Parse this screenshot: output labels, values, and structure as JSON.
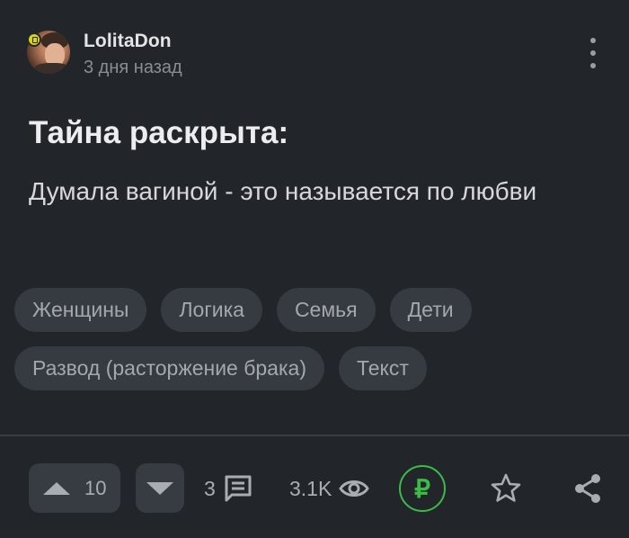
{
  "author": {
    "username": "LolitaDon",
    "posted_ago": "3 дня назад"
  },
  "post": {
    "title": "Тайна раскрыта:",
    "body": "Думала вагиной - это называется по любви"
  },
  "tags": [
    [
      "Женщины",
      "Логика",
      "Семья",
      "Дети"
    ],
    [
      "Развод (расторжение брака)",
      "Текст"
    ]
  ],
  "footer": {
    "rating": "10",
    "comments": "3",
    "views": "3.1K",
    "donate_symbol": "₽"
  },
  "colors": {
    "background": "#22262b",
    "tag_bg": "#363b41",
    "accent_green": "#3dbb47",
    "muted_text": "#a9adb2"
  },
  "icons": [
    "menu-dots-icon",
    "arrow-up-icon",
    "arrow-down-icon",
    "comment-icon",
    "eye-icon",
    "ruble-icon",
    "star-icon",
    "share-icon"
  ]
}
